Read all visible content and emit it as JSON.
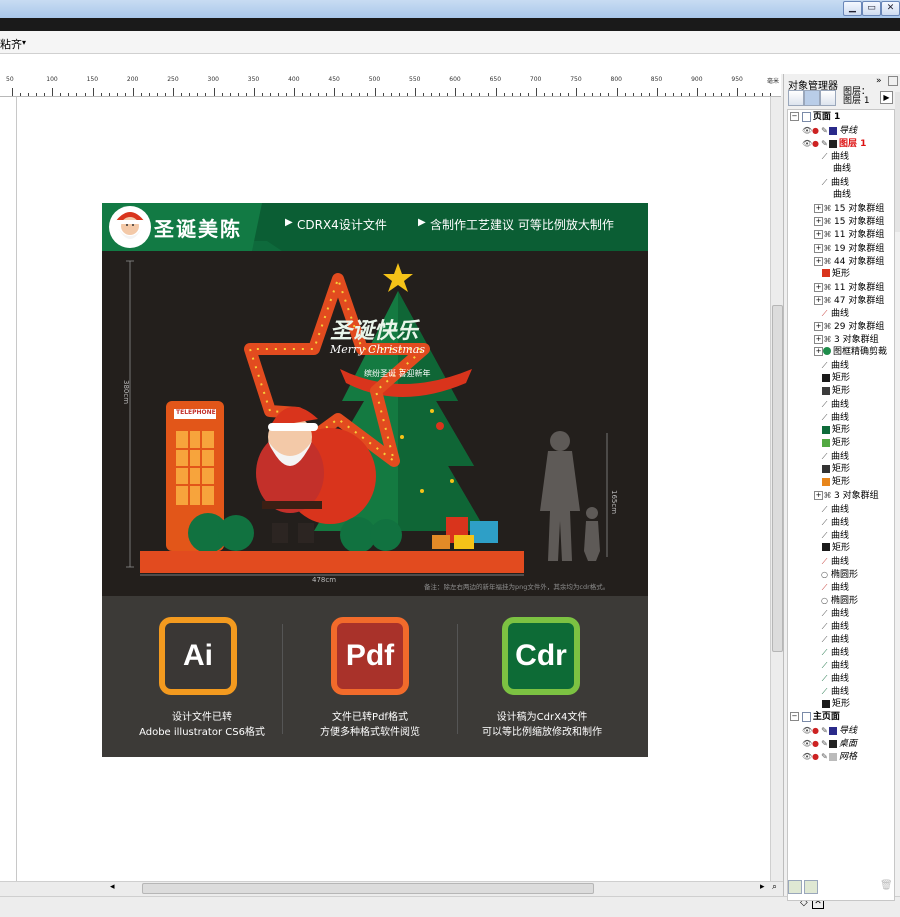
{
  "window": {
    "minimize": "▁",
    "maximize": "▭",
    "close": "✕"
  },
  "menu": {
    "item": "粘齐"
  },
  "ruler": {
    "labels": [
      "50",
      "100",
      "150",
      "200",
      "250",
      "300",
      "350",
      "400",
      "450",
      "500",
      "550",
      "600",
      "650",
      "700",
      "750",
      "800",
      "850",
      "900",
      "950"
    ],
    "unit": "毫米"
  },
  "artwork": {
    "title": "圣诞美陈",
    "header_feature1": "CDRX4设计文件",
    "header_feature2": "含制作工艺建议 可等比例放大制作",
    "tree_title": "圣诞快乐",
    "tree_subtitle": "Merry Christmas",
    "banner": "缤纷圣诞 喜迎新年",
    "booth_sign": "TELEPHONE",
    "dim_height": "380cm",
    "dim_width": "478cm",
    "dim_person": "165cm",
    "note": "备注：除左右两边的新年福挂为png文件外，其余均为cdr格式。",
    "tiles": [
      {
        "label": "Ai",
        "caption1": "设计文件已转",
        "caption2": "Adobe illustrator CS6格式",
        "border": "#f39a1f",
        "fill": "#3a3735"
      },
      {
        "label": "Pdf",
        "caption1": "文件已转Pdf格式",
        "caption2": "方便多种格式软件阅览",
        "border": "#f26b2b",
        "fill": "#a9322a"
      },
      {
        "label": "Cdr",
        "caption1": "设计稿为CdrX4文件",
        "caption2": "可以等比例缩放修改和制作",
        "border": "#7cc242",
        "fill": "#0d6b36"
      }
    ]
  },
  "panel": {
    "title": "对象管理器",
    "layer_label1": "图层：",
    "layer_label2": "图层 1",
    "rows": [
      {
        "text": "页面 1",
        "type": "page",
        "indent": 0
      },
      {
        "text": "导线",
        "type": "layer-guides",
        "indent": 1,
        "color": "#2a2a8a"
      },
      {
        "text": "图层 1",
        "type": "layer-active",
        "indent": 1,
        "color": "#222222"
      },
      {
        "text": "曲线",
        "type": "curve",
        "indent": 2
      },
      {
        "text": "曲线",
        "type": "plain",
        "indent": 2
      },
      {
        "text": "曲线",
        "type": "curve",
        "indent": 2
      },
      {
        "text": "曲线",
        "type": "plain",
        "indent": 2
      },
      {
        "text": "15 对象群组",
        "type": "group",
        "indent": 2
      },
      {
        "text": "15 对象群组",
        "type": "group",
        "indent": 2
      },
      {
        "text": "11 对象群组",
        "type": "group",
        "indent": 2
      },
      {
        "text": "19 对象群组",
        "type": "group",
        "indent": 2
      },
      {
        "text": "44 对象群组",
        "type": "group",
        "indent": 2
      },
      {
        "text": "矩形",
        "type": "rect",
        "indent": 2,
        "color": "#d9341c"
      },
      {
        "text": "11 对象群组",
        "type": "group",
        "indent": 2
      },
      {
        "text": "47 对象群组",
        "type": "group",
        "indent": 2
      },
      {
        "text": "曲线",
        "type": "curve-red",
        "indent": 2
      },
      {
        "text": "29 对象群组",
        "type": "group",
        "indent": 2
      },
      {
        "text": "3 对象群组",
        "type": "group",
        "indent": 2
      },
      {
        "text": "图框精确剪裁",
        "type": "powerclip",
        "indent": 2
      },
      {
        "text": "曲线",
        "type": "curve",
        "indent": 2
      },
      {
        "text": "矩形",
        "type": "rect",
        "indent": 2,
        "color": "#1a1a1a"
      },
      {
        "text": "矩形",
        "type": "rect",
        "indent": 2,
        "color": "#3b3b3b"
      },
      {
        "text": "曲线",
        "type": "curve",
        "indent": 2
      },
      {
        "text": "曲线",
        "type": "curve",
        "indent": 2
      },
      {
        "text": "矩形",
        "type": "rect",
        "indent": 2,
        "color": "#0e6b3a"
      },
      {
        "text": "矩形",
        "type": "rect",
        "indent": 2,
        "color": "#52a942"
      },
      {
        "text": "曲线",
        "type": "curve",
        "indent": 2
      },
      {
        "text": "矩形",
        "type": "rect",
        "indent": 2,
        "color": "#333333"
      },
      {
        "text": "矩形",
        "type": "rect",
        "indent": 2,
        "color": "#e8861b"
      },
      {
        "text": "3 对象群组",
        "type": "group",
        "indent": 2
      },
      {
        "text": "曲线",
        "type": "curve",
        "indent": 2
      },
      {
        "text": "曲线",
        "type": "curve",
        "indent": 2
      },
      {
        "text": "曲线",
        "type": "curve",
        "indent": 2
      },
      {
        "text": "矩形",
        "type": "rect",
        "indent": 2,
        "color": "#1a1a1a"
      },
      {
        "text": "曲线",
        "type": "curve-red",
        "indent": 2
      },
      {
        "text": "椭圆形",
        "type": "ellipse",
        "indent": 2
      },
      {
        "text": "曲线",
        "type": "curve-red",
        "indent": 2
      },
      {
        "text": "椭圆形",
        "type": "ellipse",
        "indent": 2
      },
      {
        "text": "曲线",
        "type": "curve",
        "indent": 2
      },
      {
        "text": "曲线",
        "type": "curve",
        "indent": 2
      },
      {
        "text": "曲线",
        "type": "curve",
        "indent": 2
      },
      {
        "text": "曲线",
        "type": "curve-green",
        "indent": 2
      },
      {
        "text": "曲线",
        "type": "curve-green",
        "indent": 2
      },
      {
        "text": "曲线",
        "type": "curve-green",
        "indent": 2
      },
      {
        "text": "曲线",
        "type": "curve-green",
        "indent": 2
      },
      {
        "text": "矩形",
        "type": "rect",
        "indent": 2,
        "color": "#1a1a1a"
      },
      {
        "text": "主页面",
        "type": "page",
        "indent": 0
      },
      {
        "text": "导线",
        "type": "layer-guides",
        "indent": 1,
        "color": "#2a2a8a"
      },
      {
        "text": "桌面",
        "type": "layer-guides",
        "indent": 1,
        "color": "#222222"
      },
      {
        "text": "网格",
        "type": "layer-grid",
        "indent": 1,
        "color": "#bbbbbb"
      }
    ]
  }
}
